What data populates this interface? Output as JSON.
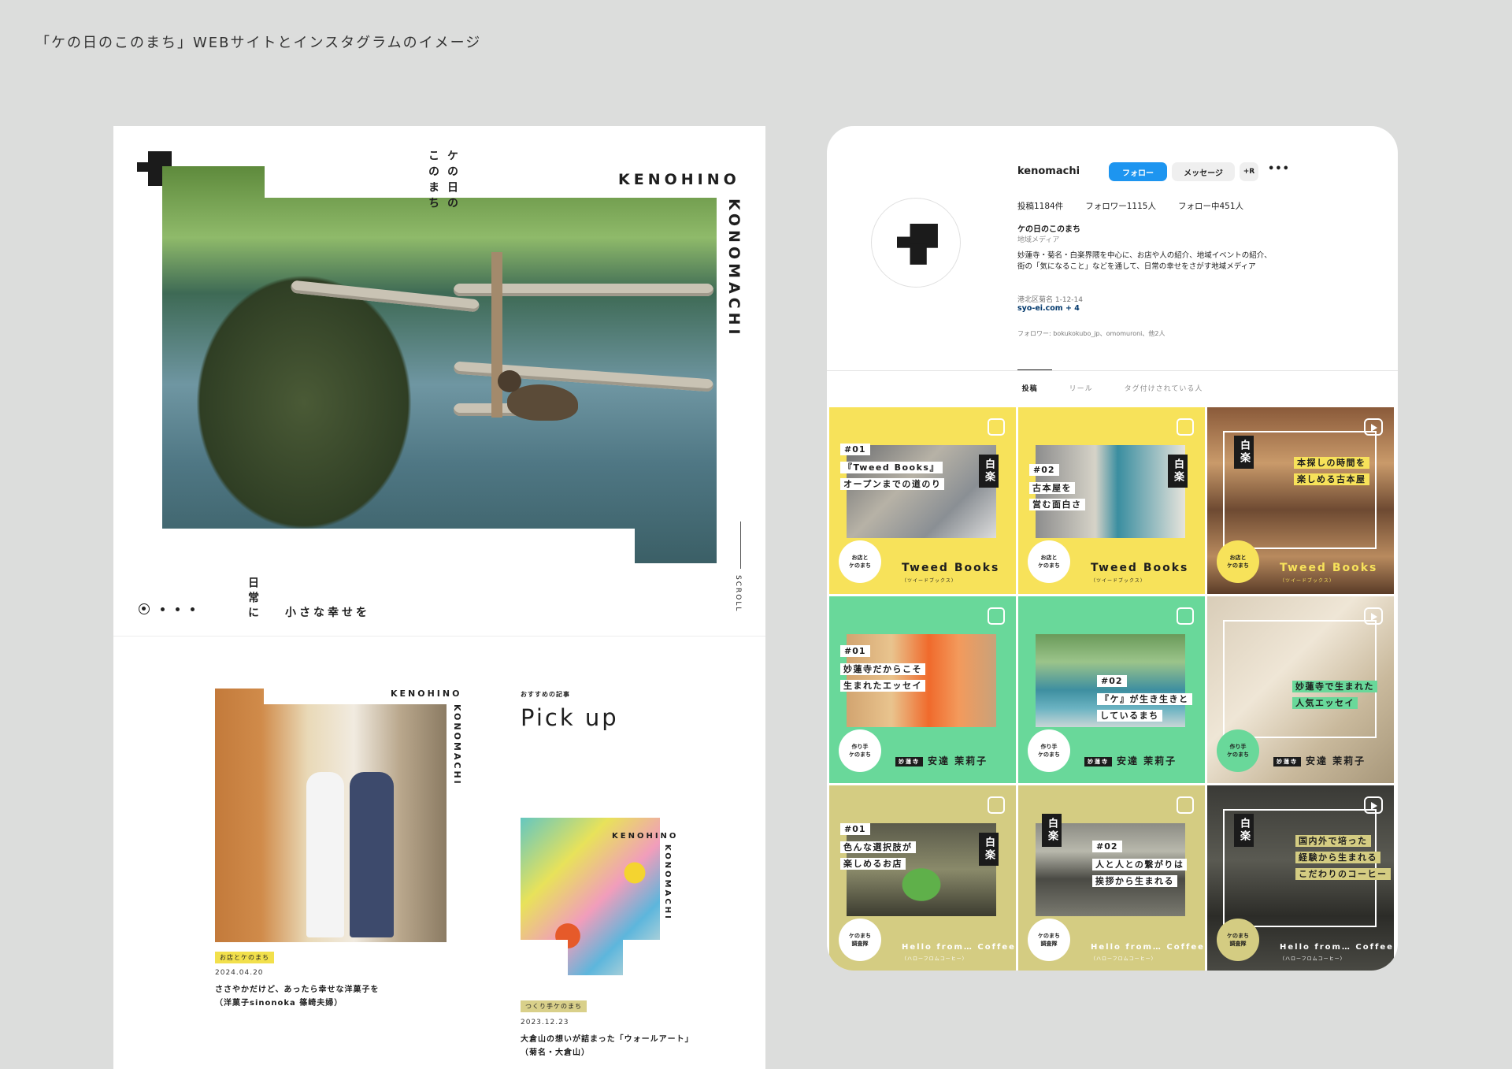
{
  "caption": "「ケの日のこのまち」WEBサイトとインスタグラムのイメージ",
  "web": {
    "jp_title_col1": "ケの日の",
    "jp_title_col2": "このまち",
    "brand_line1": "KENOHINO",
    "brand_line2": "KONOMACHI",
    "scroll": "SCROLL",
    "tagline_vertical": "日常に",
    "tagline_horizontal": "小さな幸せを",
    "recommend": "おすすめの記事",
    "pickup": "Pick up",
    "card1": {
      "brand1": "KENOHINO",
      "brand2": "KONOMACHI",
      "tag": "お店とケのまち",
      "date": "2024.04.20",
      "title1": "ささやかだけど、あったら幸せな洋菓子を",
      "title2": "（洋菓子sinonoka 篠崎夫婦）"
    },
    "card2": {
      "brand1": "KENOHINO",
      "brand2": "KONOMACHI",
      "tag": "つくり手ケのまち",
      "date": "2023.12.23",
      "title1": "大倉山の想いが詰まった「ウォールアート」",
      "title2": "（菊名・大倉山）"
    }
  },
  "ig": {
    "username": "kenomachi",
    "follow": "フォロー",
    "message": "メッセージ",
    "add": "+R",
    "more": "•••",
    "posts": "投稿1184件",
    "followers": "フォロワー1115人",
    "following": "フォロー中451人",
    "display_name": "ケの日のこのまち",
    "category": "地域メディア",
    "bio1": "妙蓮寺・菊名・白楽界隈を中心に、お店や人の紹介、地域イベントの紹介、",
    "bio2": "街の「気になること」などを通して、日常の幸せをさがす地域メディア",
    "address": "港北区菊名 1-12-14",
    "link": "syo-ei.com + 4",
    "followed_by": "フォロワー: bokukokubo_jp、omomuroni、他2人",
    "tabs": [
      "投稿",
      "リール",
      "タグ付けされている人"
    ],
    "tiles": [
      {
        "num": "#01",
        "lines": [
          "『Tweed Books』",
          "オープンまでの道のり"
        ],
        "badge": "白楽",
        "shop": "Tweed Books",
        "shop_sub": "（ツイードブックス）",
        "cat": "お店と\nケのまち"
      },
      {
        "num": "#02",
        "lines": [
          "古本屋を",
          "営む面白さ"
        ],
        "badge": "白楽",
        "shop": "Tweed Books",
        "shop_sub": "（ツイードブックス）",
        "cat": "お店と\nケのまち"
      },
      {
        "num": "",
        "lines": [
          "本探しの時間を",
          "楽しめる古本屋"
        ],
        "badge": "白楽",
        "shop": "Tweed Books",
        "shop_sub": "（ツイードブックス）",
        "cat": "お店と\nケのまち"
      },
      {
        "num": "#01",
        "lines": [
          "妙蓮寺だからこそ",
          "生まれたエッセイ"
        ],
        "badge": "",
        "area": "妙蓮寺",
        "author": "安達 茉莉子",
        "cat": "作り手\nケのまち"
      },
      {
        "num": "#02",
        "lines": [
          "『ケ』が生き生きと",
          "しているまち"
        ],
        "badge": "",
        "area": "妙蓮寺",
        "author": "安達 茉莉子",
        "cat": "作り手\nケのまち"
      },
      {
        "num": "",
        "lines": [
          "妙蓮寺で生まれた",
          "人気エッセイ"
        ],
        "badge": "",
        "area": "妙蓮寺",
        "author": "安達 茉莉子",
        "cat": "作り手\nケのまち"
      },
      {
        "num": "#01",
        "lines": [
          "色んな選択肢が",
          "楽しめるお店"
        ],
        "badge": "白楽",
        "shop": "Hello from… Coffee",
        "shop_sub": "（ハローフロムコーヒー）",
        "cat": "ケのまち\n調査隊"
      },
      {
        "num": "#02",
        "lines": [
          "人と人との繋がりは",
          "挨拶から生まれる"
        ],
        "badge": "白楽",
        "shop": "Hello from… Coffee",
        "shop_sub": "（ハローフロムコーヒー）",
        "cat": "ケのまち\n調査隊"
      },
      {
        "num": "",
        "lines": [
          "国内外で培った",
          "経験から生まれる",
          "こだわりのコーヒー"
        ],
        "badge": "白楽",
        "shop": "Hello from… Coffee",
        "shop_sub": "（ハローフロムコーヒー）",
        "cat": "ケのまち\n調査隊"
      }
    ]
  }
}
